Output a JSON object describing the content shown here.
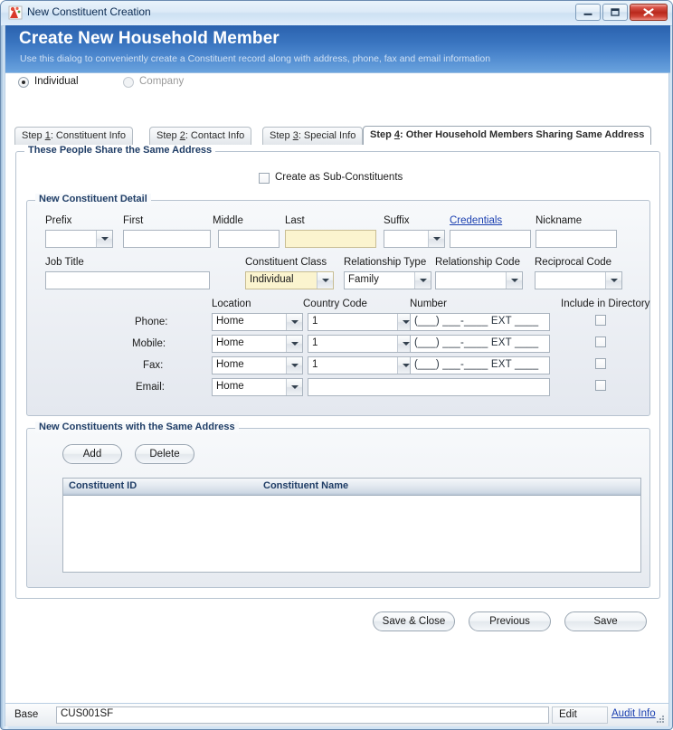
{
  "window": {
    "title": "New Constituent Creation",
    "icon": "app-icon",
    "controls": {
      "minimize": "minimize-button",
      "maximize": "maximize-button",
      "close": "close-button"
    }
  },
  "banner": {
    "title": "Create New Household Member",
    "subtitle": "Use this dialog to conveniently create a Constituent record along with address, phone, fax and email information"
  },
  "entity_type": {
    "options": [
      {
        "label": "Individual",
        "selected": true,
        "disabled": false
      },
      {
        "label": "Company",
        "selected": false,
        "disabled": true
      }
    ]
  },
  "tabs": [
    {
      "prefix": "Step ",
      "mnemonic": "1",
      "label": ": Constituent Info",
      "active": false
    },
    {
      "prefix": "Step ",
      "mnemonic": "2",
      "label": ": Contact Info",
      "active": false
    },
    {
      "prefix": "Step ",
      "mnemonic": "3",
      "label": ": Special Info",
      "active": false
    },
    {
      "prefix": "Step ",
      "mnemonic": "4",
      "label": ":  Other Household Members Sharing Same Address",
      "active": true
    }
  ],
  "outer_group": {
    "title": "These People Share the Same Address",
    "sub_constituents_checkbox": {
      "label": "Create as Sub-Constituents",
      "checked": false
    }
  },
  "detail_group": {
    "title": "New Constituent Detail",
    "name_fields": [
      {
        "label": "Prefix",
        "type": "combo",
        "value": "",
        "required": false
      },
      {
        "label": "First",
        "type": "text",
        "value": "",
        "required": false
      },
      {
        "label": "Middle",
        "type": "text",
        "value": "",
        "required": false
      },
      {
        "label": "Last",
        "type": "text",
        "value": "",
        "required": true
      },
      {
        "label": "Suffix",
        "type": "combo",
        "value": "",
        "required": false
      },
      {
        "label": "Credentials",
        "type": "text",
        "value": "",
        "required": false,
        "is_link": true
      },
      {
        "label": "Nickname",
        "type": "text",
        "value": "",
        "required": false
      }
    ],
    "second_row": [
      {
        "label": "Job Title",
        "type": "text",
        "value": "",
        "required": false
      },
      {
        "label": "Constituent Class",
        "type": "combo",
        "value": "Individual",
        "required": true
      },
      {
        "label": "Relationship Type",
        "type": "combo",
        "value": "Family",
        "required": false
      },
      {
        "label": "Relationship Code",
        "type": "combo",
        "value": "",
        "required": false
      },
      {
        "label": "Reciprocal Code",
        "type": "combo",
        "value": "",
        "required": false
      }
    ],
    "contact_headers": {
      "location": "Location",
      "country_code": "Country Code",
      "number": "Number",
      "include_in_directory": "Include in Directory"
    },
    "contact_rows": [
      {
        "label": "Phone:",
        "location": "Home",
        "country_code": "1",
        "number": "(___) ___-____ EXT ____",
        "wide_value": null,
        "include": false
      },
      {
        "label": "Mobile:",
        "location": "Home",
        "country_code": "1",
        "number": "(___) ___-____ EXT ____",
        "wide_value": null,
        "include": false
      },
      {
        "label": "Fax:",
        "location": "Home",
        "country_code": "1",
        "number": "(___) ___-____ EXT ____",
        "wide_value": null,
        "include": false
      },
      {
        "label": "Email:",
        "location": "Home",
        "country_code": null,
        "number": null,
        "wide_value": "",
        "include": false
      }
    ]
  },
  "list_group": {
    "title": "New Constituents with the Same Address",
    "buttons": {
      "add": "Add",
      "delete": "Delete"
    },
    "grid": {
      "columns": [
        "Constituent ID",
        "Constituent Name"
      ],
      "rows": []
    }
  },
  "actions": {
    "save_and_close": "Save & Close",
    "previous": "Previous",
    "save": "Save"
  },
  "statusbar": {
    "base_label": "Base",
    "base_value": "CUS001SF",
    "edit_label": "Edit",
    "audit_link": "Audit Info"
  },
  "colors": {
    "banner_start": "#2a62ae",
    "banner_end": "#6aa3de",
    "required_field": "#fbf4cf",
    "link": "#1a3fb0",
    "group_title": "#1f3d66",
    "close_button": "#b8281c"
  }
}
